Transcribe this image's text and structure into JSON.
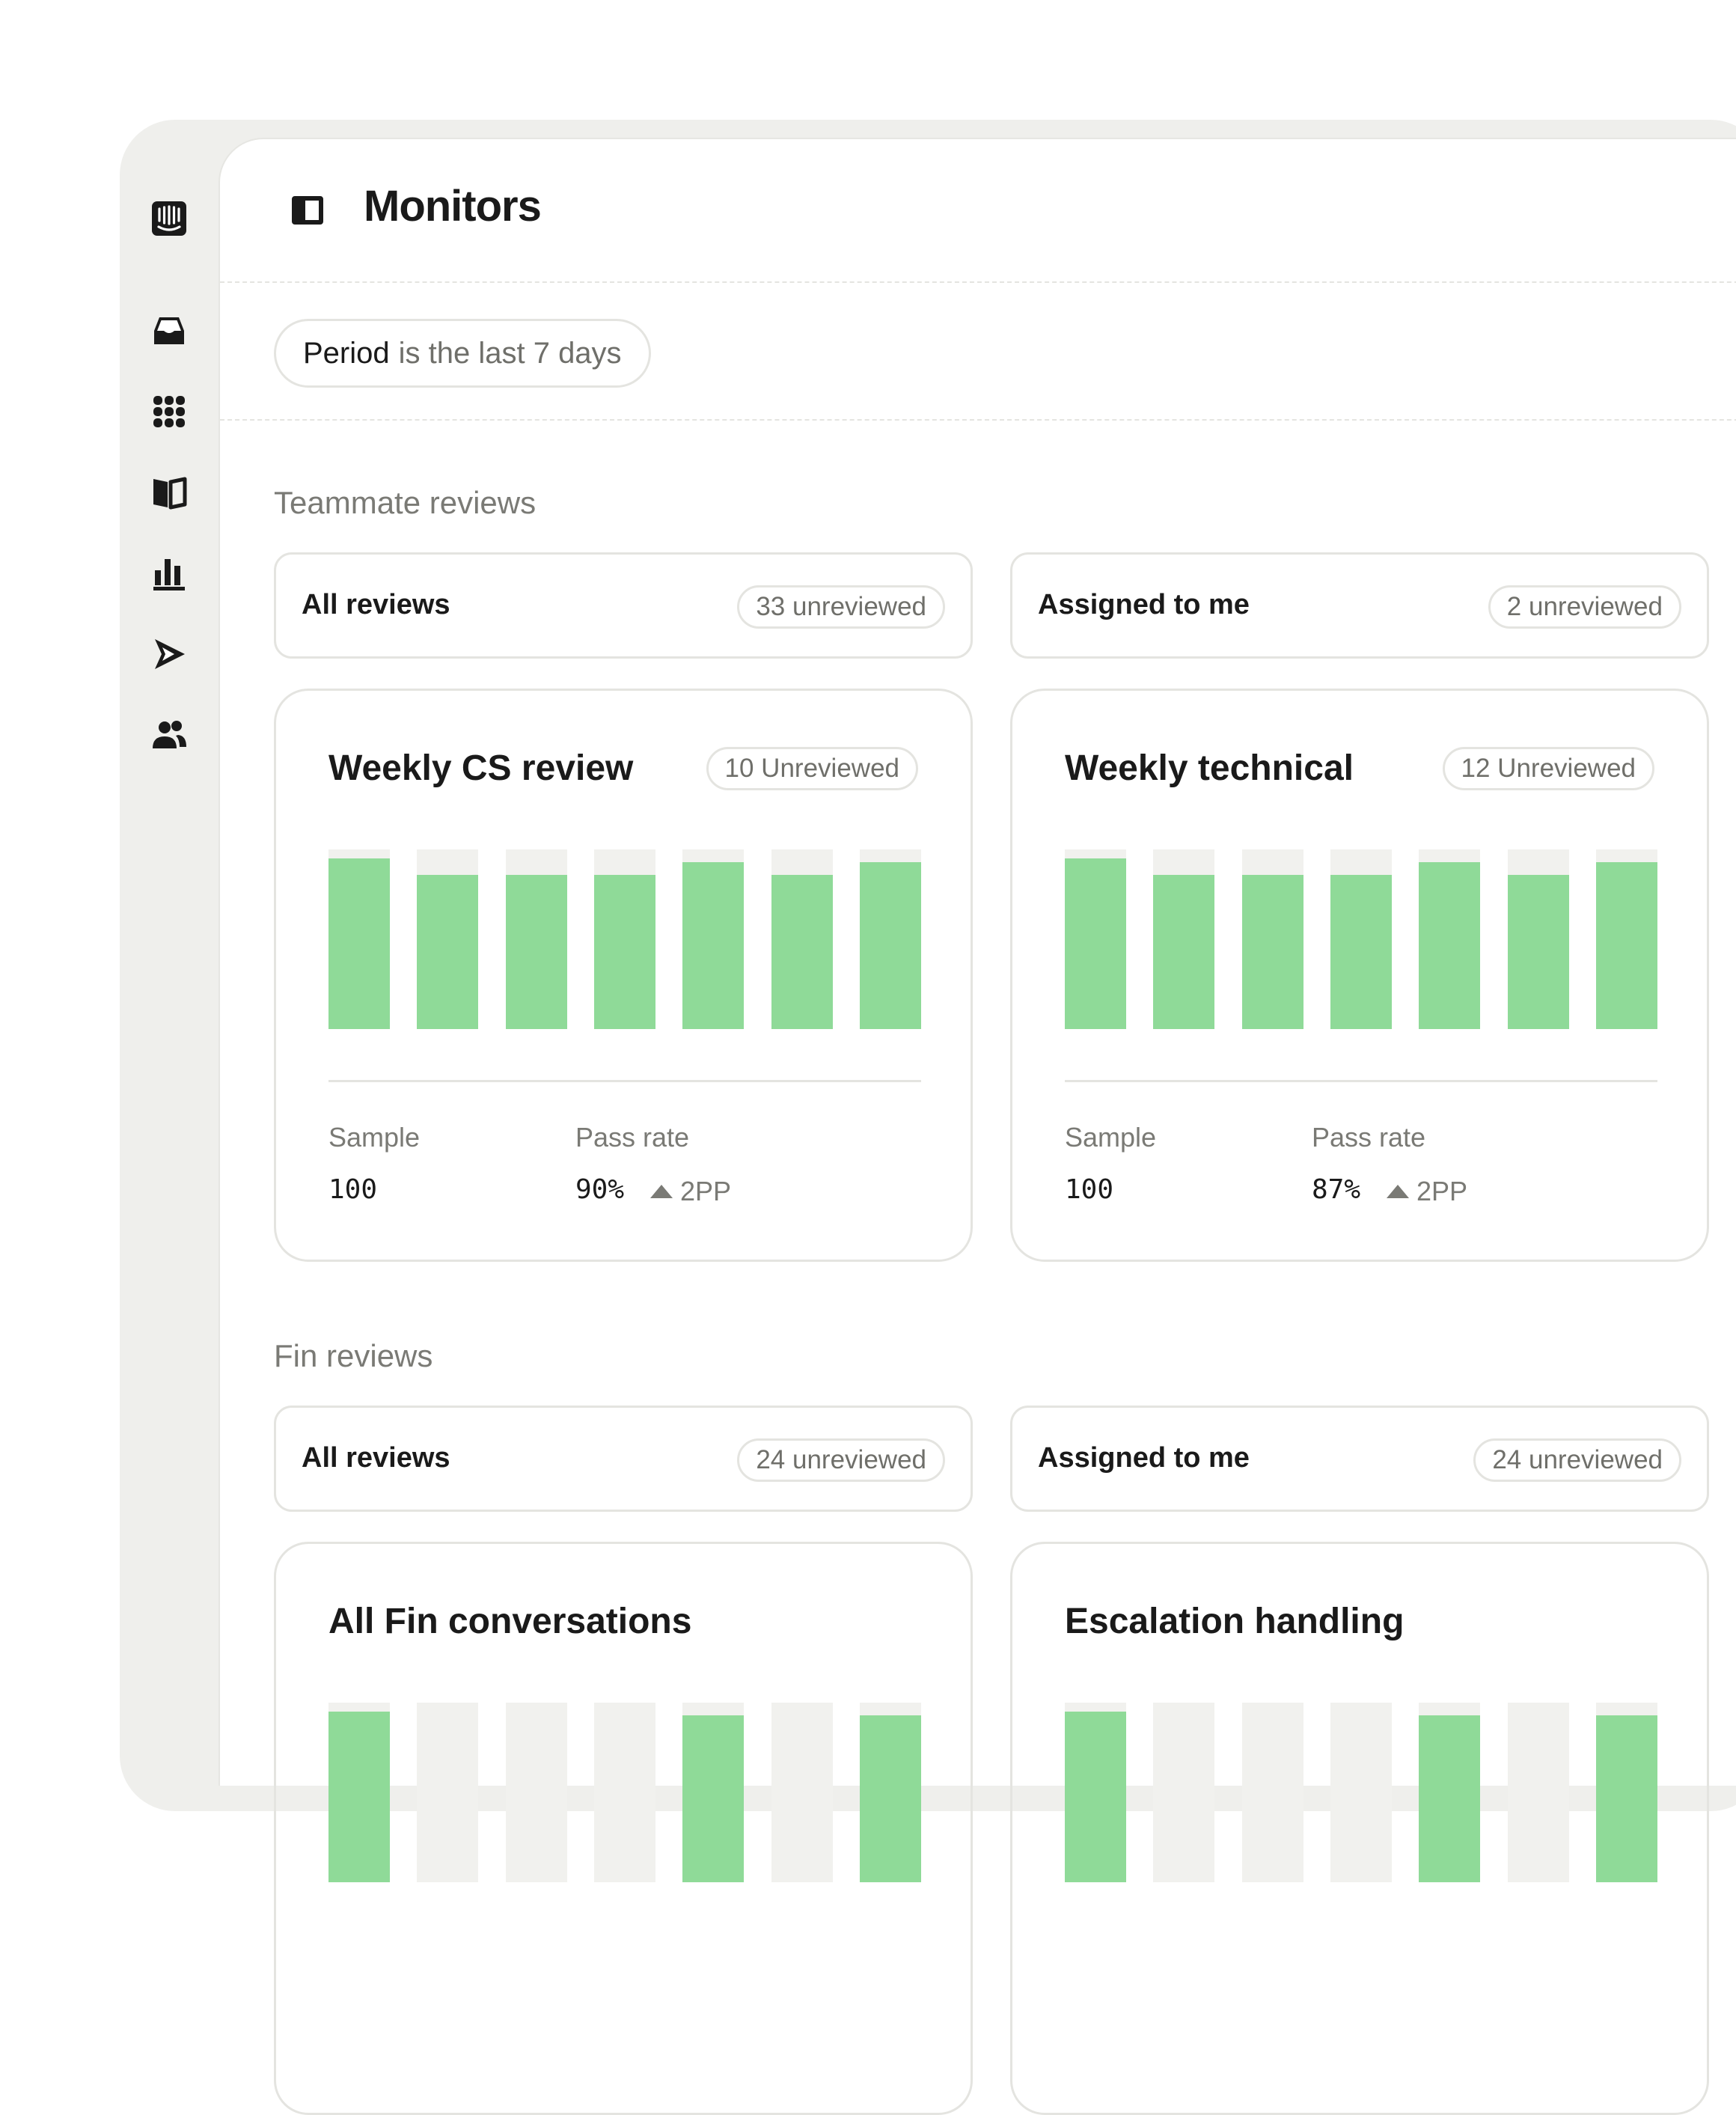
{
  "page": {
    "title": "Monitors"
  },
  "rail": {
    "icons": [
      "intercom-logo-icon",
      "inbox-icon",
      "apps-grid-icon",
      "book-icon",
      "reports-chart-icon",
      "outbound-send-icon",
      "contacts-people-icon"
    ]
  },
  "filter": {
    "field": "Period",
    "condition": "is the last 7 days"
  },
  "colors": {
    "bar_fill": "#8fda98",
    "bar_track": "#f1f1ee",
    "border": "#e4e4e0",
    "frame": "#efefec"
  },
  "sections": {
    "teammate": {
      "label": "Teammate reviews",
      "all_reviews": {
        "label": "All reviews",
        "badge": "33 unreviewed"
      },
      "assigned": {
        "label": "Assigned to me",
        "badge": "2 unreviewed"
      },
      "monitors": [
        {
          "title": "Weekly CS review",
          "badge": "10 Unreviewed",
          "sample_label": "Sample",
          "sample": "100",
          "pass_label": "Pass rate",
          "pass_rate": "90%",
          "delta": "2PP",
          "bars": [
            0.95,
            0.86,
            0.86,
            0.86,
            0.93,
            0.86,
            0.93
          ]
        },
        {
          "title": "Weekly technical",
          "badge": "12 Unreviewed",
          "sample_label": "Sample",
          "sample": "100",
          "pass_label": "Pass rate",
          "pass_rate": "87%",
          "delta": "2PP",
          "bars": [
            0.95,
            0.86,
            0.86,
            0.86,
            0.93,
            0.86,
            0.93
          ]
        }
      ]
    },
    "fin": {
      "label": "Fin reviews",
      "all_reviews": {
        "label": "All reviews",
        "badge": "24 unreviewed"
      },
      "assigned": {
        "label": "Assigned to me",
        "badge": "24 unreviewed"
      },
      "monitors": [
        {
          "title": "All Fin conversations",
          "bars": [
            0.95,
            0.0,
            0.0,
            0.0,
            0.93,
            0.0,
            0.93
          ]
        },
        {
          "title": "Escalation handling",
          "bars": [
            0.95,
            0.0,
            0.0,
            0.0,
            0.93,
            0.0,
            0.93
          ]
        }
      ]
    }
  }
}
